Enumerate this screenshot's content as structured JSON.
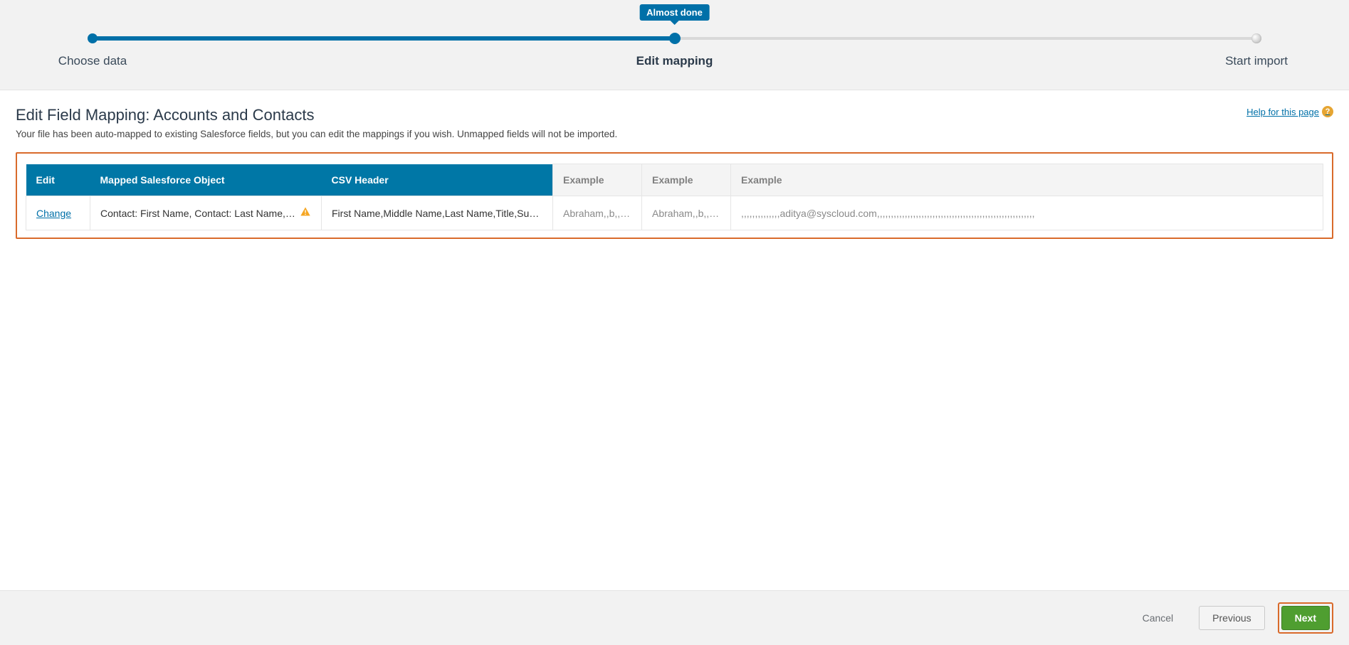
{
  "wizard": {
    "tooltip": "Almost done",
    "steps": [
      {
        "label": "Choose data",
        "state": "done"
      },
      {
        "label": "Edit mapping",
        "state": "current"
      },
      {
        "label": "Start import",
        "state": "pending"
      }
    ]
  },
  "help": {
    "label": "Help for this page"
  },
  "page": {
    "title": "Edit Field Mapping: Accounts and Contacts",
    "subtitle": "Your file has been auto-mapped to existing Salesforce fields, but you can edit the mappings if you wish. Unmapped fields will not be imported."
  },
  "table": {
    "headers": {
      "edit": "Edit",
      "mapped": "Mapped Salesforce Object",
      "csv": "CSV Header",
      "ex1": "Example",
      "ex2": "Example",
      "ex3": "Example"
    },
    "row": {
      "edit_action": "Change",
      "mapped_text": "Contact: First Name, Contact: Last Name,…",
      "csv_text": "First Name,Middle Name,Last Name,Title,Su…",
      "ex1": "Abraham,,b,,,,,,,,,,,",
      "ex2": "Abraham,,b,,,,,,,,,,,",
      "ex3": ",,,,,,,,,,,,,,aditya@syscloud.com,,,,,,,,,,,,,,,,,,,,,,,,,,,,,,,,,,,,,,,,,,,,,,,,,,,,,,,,,"
    }
  },
  "footer": {
    "cancel": "Cancel",
    "previous": "Previous",
    "next": "Next"
  }
}
